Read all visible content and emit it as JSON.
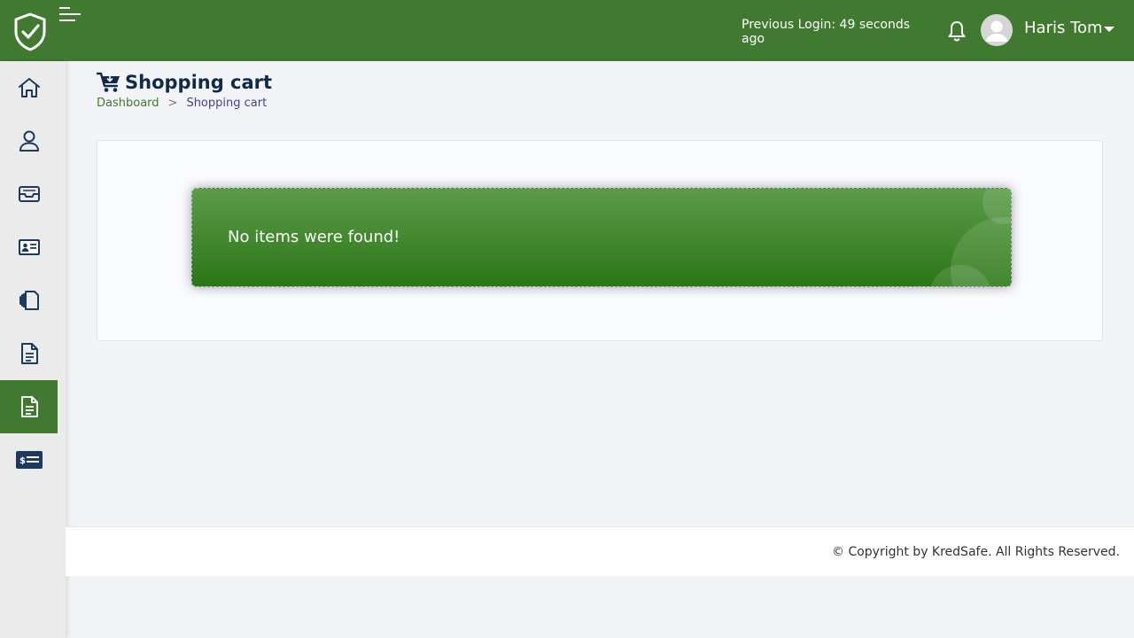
{
  "header": {
    "previous_login": "Previous Login: 49 seconds ago",
    "user_name": "Haris Tom",
    "logo_icon": "shield-check-icon",
    "menu_icon": "hamburger-icon",
    "notification_icon": "bell-icon"
  },
  "sidebar": {
    "items": [
      {
        "icon": "home-icon",
        "active": false
      },
      {
        "icon": "user-icon",
        "active": false
      },
      {
        "icon": "inbox-icon",
        "active": false
      },
      {
        "icon": "id-card-icon",
        "active": false
      },
      {
        "icon": "documents-icon",
        "active": false
      },
      {
        "icon": "document-icon",
        "active": false
      },
      {
        "icon": "document-icon",
        "active": true
      },
      {
        "icon": "billing-card-icon",
        "active": false
      }
    ]
  },
  "page": {
    "title": "Shopping cart",
    "title_icon": "cart-icon",
    "breadcrumb": {
      "home": "Dashboard",
      "separator": ">",
      "current": "Shopping cart"
    }
  },
  "alert": {
    "message": "No items were found!"
  },
  "footer": {
    "copyright": "© Copyright by KredSafe. All Rights Reserved."
  },
  "colors": {
    "primary_green": "#407a30",
    "navy": "#102a4c",
    "background": "#f3f4f8"
  }
}
